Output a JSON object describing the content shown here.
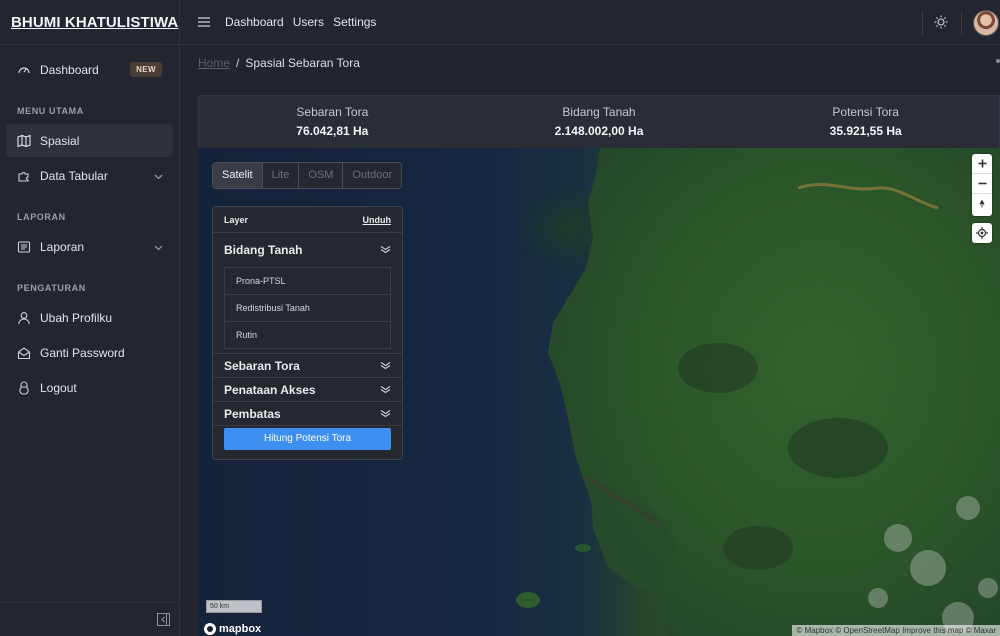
{
  "brand": {
    "title": "BHUMI KHATULISTIWA"
  },
  "sidebar": {
    "dashboard": {
      "label": "Dashboard",
      "badge": "NEW"
    },
    "sections": {
      "menu_utama": "MENU UTAMA",
      "laporan": "LAPORAN",
      "pengaturan": "PENGATURAN"
    },
    "items": {
      "spasial": "Spasial",
      "data_tabular": "Data Tabular",
      "laporan": "Laporan",
      "ubah_profil": "Ubah Profilku",
      "ganti_password": "Ganti Password",
      "logout": "Logout"
    }
  },
  "topbar": {
    "links": [
      "Dashboard",
      "Users",
      "Settings"
    ]
  },
  "breadcrumb": {
    "home": "Home",
    "separator": "/",
    "current": "Spasial Sebaran Tora"
  },
  "stats": [
    {
      "label": "Sebaran Tora",
      "value": "76.042,81 Ha"
    },
    {
      "label": "Bidang Tanah",
      "value": "2.148.002,00 Ha"
    },
    {
      "label": "Potensi Tora",
      "value": "35.921,55 Ha"
    }
  ],
  "basemap": {
    "options": [
      "Satelit",
      "Lite",
      "OSM",
      "Outdoor"
    ],
    "selected": "Satelit"
  },
  "layer_panel": {
    "title": "Layer",
    "download": "Unduh",
    "groups": [
      "Bidang Tanah",
      "Sebaran Tora",
      "Penataan Akses",
      "Pembatas"
    ],
    "bidang_tanah_items": [
      "Prona-PTSL",
      "Redistribusi Tanah",
      "Rutin"
    ],
    "action": "Hitung Potensi Tora"
  },
  "map": {
    "scale": "50 km",
    "logo": "mapbox",
    "attribution": "© Mapbox © OpenStreetMap Improve this map © Maxar"
  },
  "colors": {
    "accent": "#3d8ff0",
    "badge_bg": "#4a3d35",
    "sidebar_bg": "#23262e"
  }
}
